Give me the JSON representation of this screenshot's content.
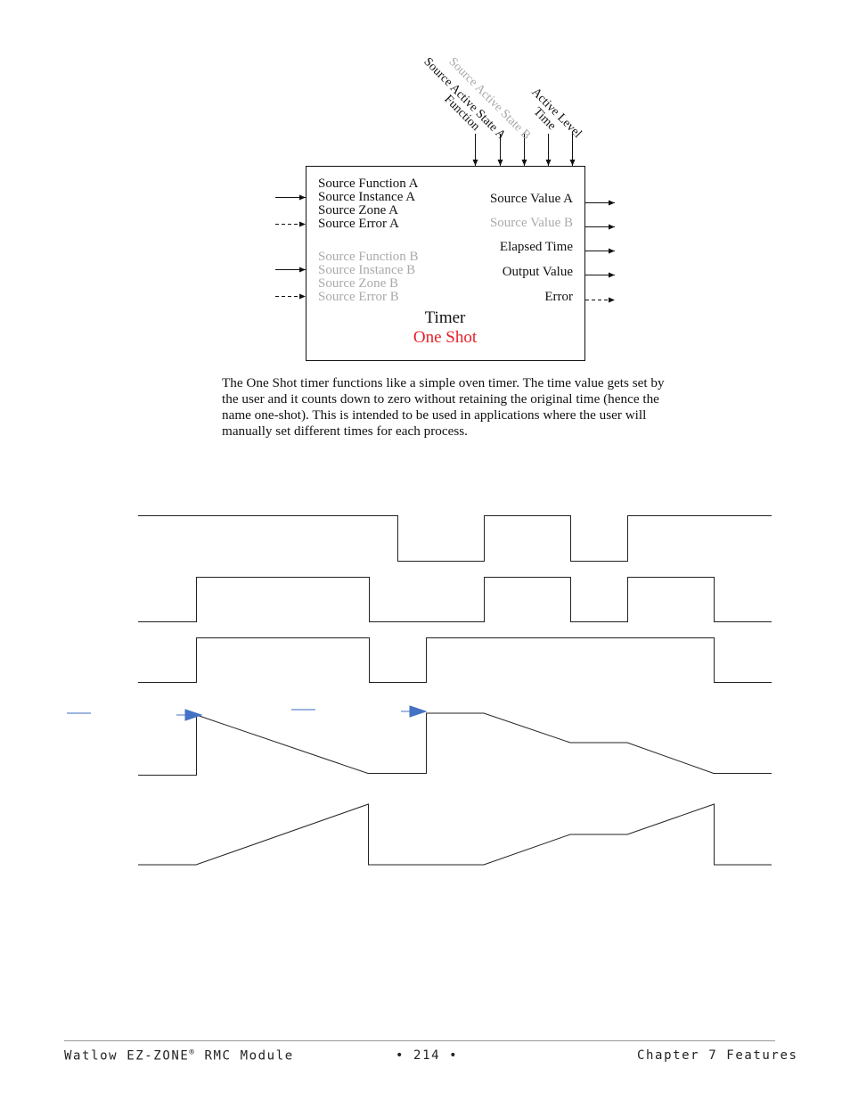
{
  "diagram": {
    "top_inputs": [
      "Function",
      "Source Active State A",
      "Source Active State B",
      "Time",
      "Active Level"
    ],
    "left_inputs_a": [
      "Source Function A",
      "Source Instance A",
      "Source Zone A",
      "Source Error A"
    ],
    "left_inputs_b": [
      "Source Function B",
      "Source Instance B",
      "Source Zone B",
      "Source Error B"
    ],
    "outputs": [
      "Source Value A",
      "Source Value B",
      "Elapsed Time",
      "Output Value",
      "Error"
    ],
    "block_title": "Timer",
    "block_subtitle": "One Shot",
    "colors": {
      "subtitle": "#e8202a",
      "inactive": "#aaaaaa",
      "marker": "#4472c4"
    }
  },
  "body_text": "The One Shot timer functions like a simple oven timer.  The time value gets set by the user and it counts down to zero without retaining the original time (hence the name one-shot). This is intended to be used in applications where the user will manually set different times for each process.",
  "footer": {
    "product": "Watlow EZ-ZONE",
    "registered": "®",
    "product_suffix": " RMC Module",
    "page": "•  214  •",
    "chapter": "Chapter 7 Features"
  }
}
